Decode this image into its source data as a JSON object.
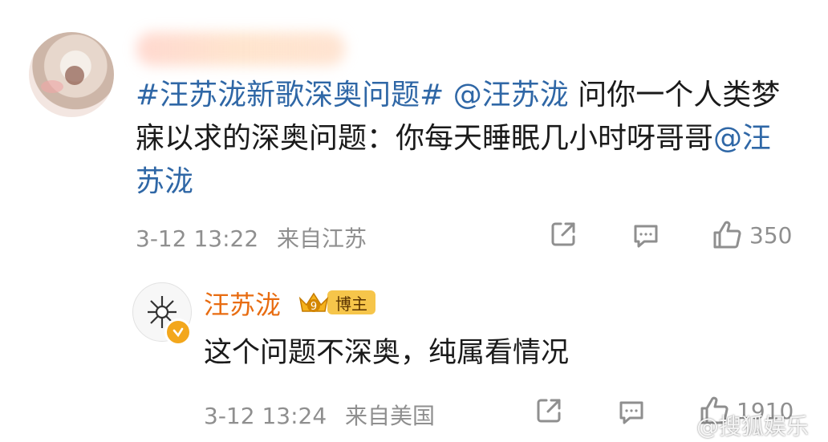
{
  "comment": {
    "text_parts": [
      {
        "text": "#汪苏泷新歌深奥问题#",
        "link": true
      },
      {
        "text": " ",
        "link": false
      },
      {
        "text": "@汪苏泷",
        "link": true
      },
      {
        "text": " 问你一个人类梦寐以求的深奥问题：你每天睡眠几小时呀哥哥",
        "link": false
      },
      {
        "text": "@汪苏泷",
        "link": true
      }
    ],
    "time": "3-12 13:22",
    "location": "来自江苏",
    "likes": "350",
    "share_icon": "share-icon",
    "comment_icon": "comment-icon",
    "like_icon": "thumbs-up-icon"
  },
  "reply": {
    "username": "汪苏泷",
    "level_badge": "9",
    "role_tag": "博主",
    "text": "这个问题不深奥，纯属看情况",
    "time": "3-12 13:24",
    "location": "来自美国",
    "likes": "1910"
  },
  "watermark": "@搜狐娱乐",
  "colors": {
    "link": "#2f67a6",
    "meta": "#8f8f8f",
    "username_reply": "#e86c11",
    "blogger_tag": "#f6c54a"
  }
}
